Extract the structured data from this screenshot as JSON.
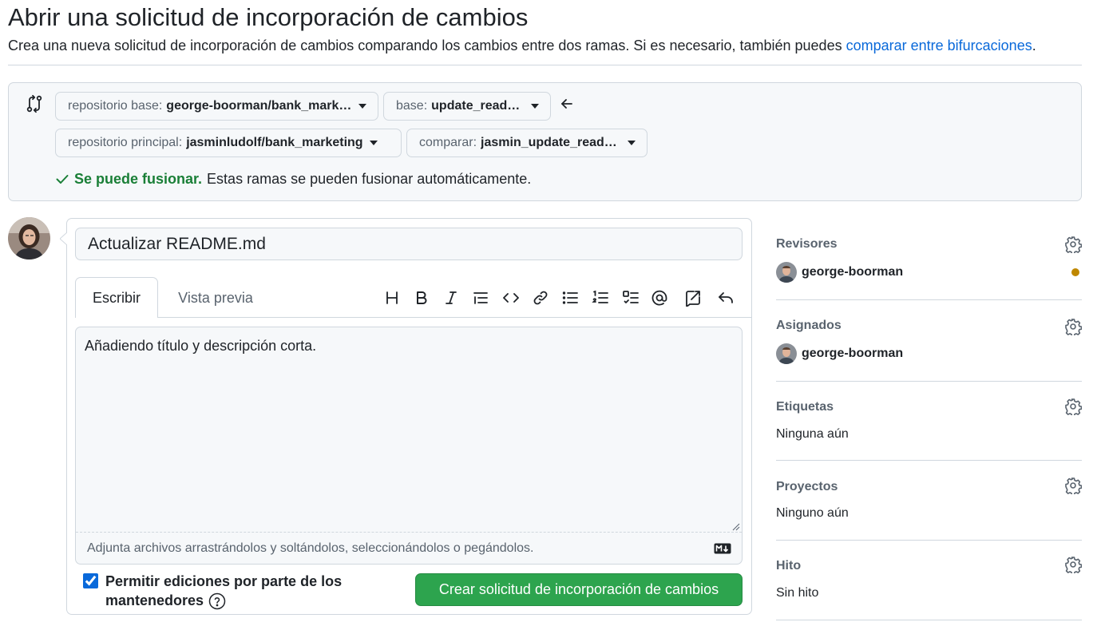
{
  "header": {
    "title": "Abrir una solicitud de incorporación de cambios",
    "subtitle": "Crea una nueva solicitud de incorporación de cambios comparando los cambios entre dos ramas. Si es necesario, también puedes ",
    "subtitle_link": "comparar entre bifurcaciones",
    "subtitle_end": "."
  },
  "compare": {
    "base_repo_label": "repositorio base:",
    "base_repo_value": "george-boorman/bank_marketing",
    "base_branch_label": "base:",
    "base_branch_value": "update_readme",
    "head_repo_label": "repositorio principal:",
    "head_repo_value": "jasminludolf/bank_marketing",
    "compare_branch_label": "comparar:",
    "compare_branch_value": "jasmin_update_readme",
    "status_ok": "Se puede fusionar.",
    "status_text": "Estas ramas se pueden fusionar automáticamente."
  },
  "form": {
    "title_value": "Actualizar README.md",
    "tab_write": "Escribir",
    "tab_preview": "Vista previa",
    "toolbar": [
      "heading-icon",
      "bold-icon",
      "italic-icon",
      "quote-icon",
      "code-icon",
      "link-icon",
      "unordered-list-icon",
      "ordered-list-icon",
      "task-list-icon",
      "mention-icon",
      "reference-icon",
      "undo-icon"
    ],
    "body_value": "Añadiendo título y descripción corta.",
    "attach_hint": "Adjunta archivos arrastrándolos y soltándolos, seleccionándolos o pegándolos.",
    "maintainer_label": "Permitir ediciones por parte de los mantenedores",
    "maintainer_checked": true,
    "create_button": "Crear solicitud de incorporación de cambios"
  },
  "sidebar": {
    "reviewers_title": "Revisores",
    "reviewer_name": "george-boorman",
    "assignees_title": "Asignados",
    "assignee_name": "george-boorman",
    "labels_title": "Etiquetas",
    "labels_value": "Ninguna aún",
    "projects_title": "Proyectos",
    "projects_value": "Ninguno aún",
    "milestone_title": "Hito",
    "milestone_value": "Sin hito"
  },
  "colors": {
    "primary_green": "#2da44e",
    "link_blue": "#0969da",
    "success_text": "#1a7f37",
    "pending_dot": "#bf8700",
    "border": "#d0d7de"
  }
}
